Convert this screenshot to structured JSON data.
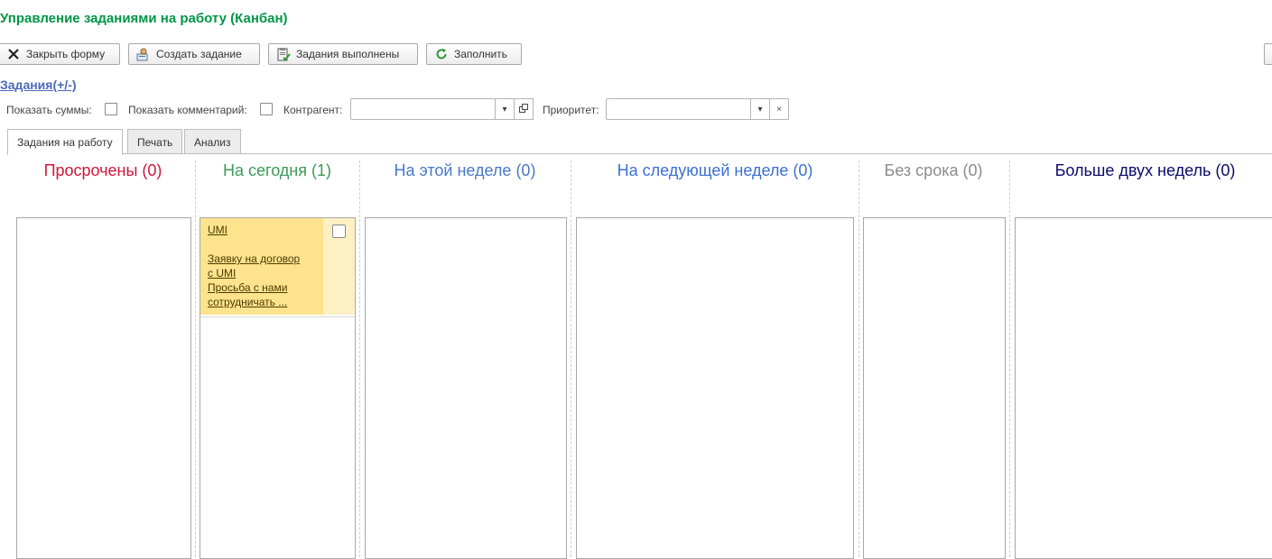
{
  "form": {
    "title": "Управление заданиями на работу (Канбан)"
  },
  "toolbar": {
    "close_label": "Закрыть форму",
    "create_label": "Создать задание",
    "done_label": "Задания выполнены",
    "fill_label": "Заполнить"
  },
  "section": {
    "title": "Задания(+/-)"
  },
  "filters": {
    "show_sums_label": "Показать суммы:",
    "show_comment_label": "Показать комментарий:",
    "counterparty_label": "Контрагент:",
    "counterparty_value": "",
    "priority_label": "Приоритет:",
    "priority_value": ""
  },
  "tabs": [
    {
      "label": "Задания на работу"
    },
    {
      "label": "Печать"
    },
    {
      "label": "Анализ"
    }
  ],
  "columns": [
    {
      "title": "Просрочены (0)",
      "color": "#d0163c"
    },
    {
      "title": "На сегодня (1)",
      "color": "#3c9a5a"
    },
    {
      "title": "На этой неделе (0)",
      "color": "#4a78c8"
    },
    {
      "title": "На следующей неделе (0)",
      "color": "#3b6fd6"
    },
    {
      "title": "Без срока (0)",
      "color": "#8c8c8c"
    },
    {
      "title": "Больше двух недель (0)",
      "color": "#0b0b6b"
    }
  ],
  "card": {
    "client": "UMI",
    "line1": "Заявку на договор",
    "line2": "с UMI",
    "line3": "Просьба с нами",
    "line4": "сотрудничать ...",
    "color": "#fde38e"
  }
}
